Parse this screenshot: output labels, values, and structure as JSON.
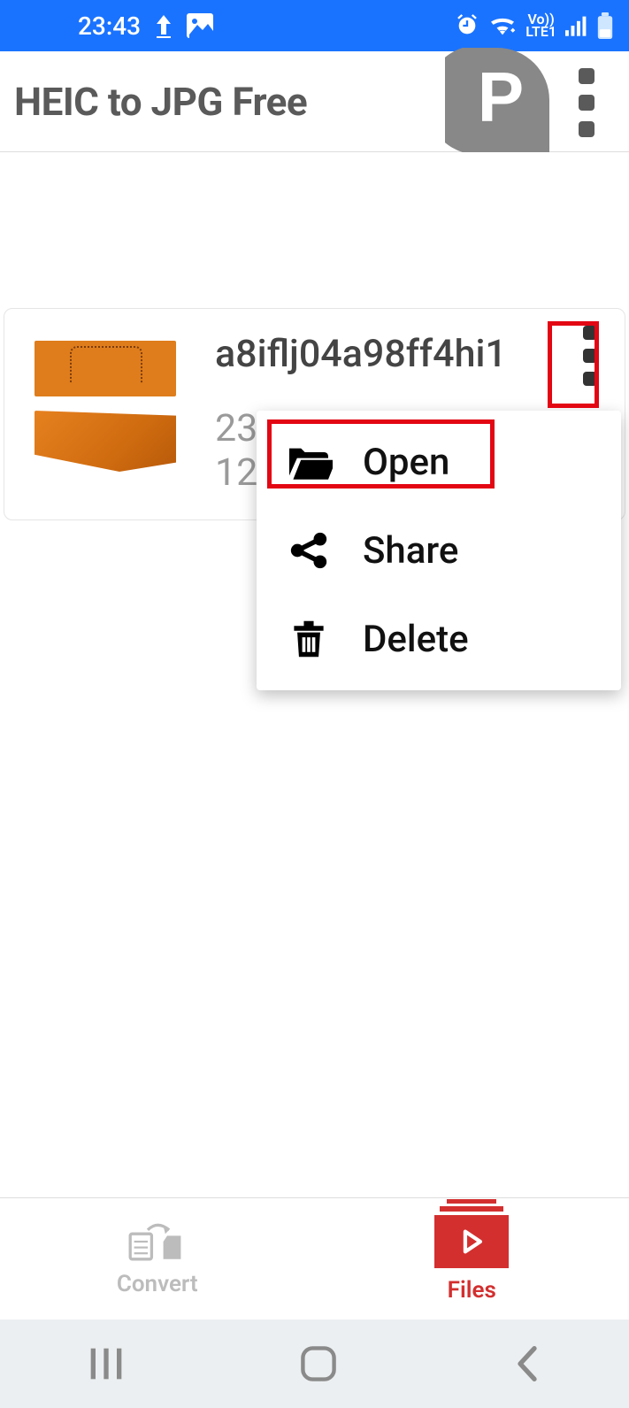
{
  "status": {
    "time": "23:43",
    "network": "LTE1",
    "vo": "Vo))"
  },
  "header": {
    "title": "HEIC to JPG Free"
  },
  "file": {
    "name": "a8iflj04a98ff4hi1",
    "line1": "23",
    "line2": "12"
  },
  "menu": {
    "open": "Open",
    "share": "Share",
    "delete": "Delete"
  },
  "tabs": {
    "convert": "Convert",
    "files": "Files"
  }
}
